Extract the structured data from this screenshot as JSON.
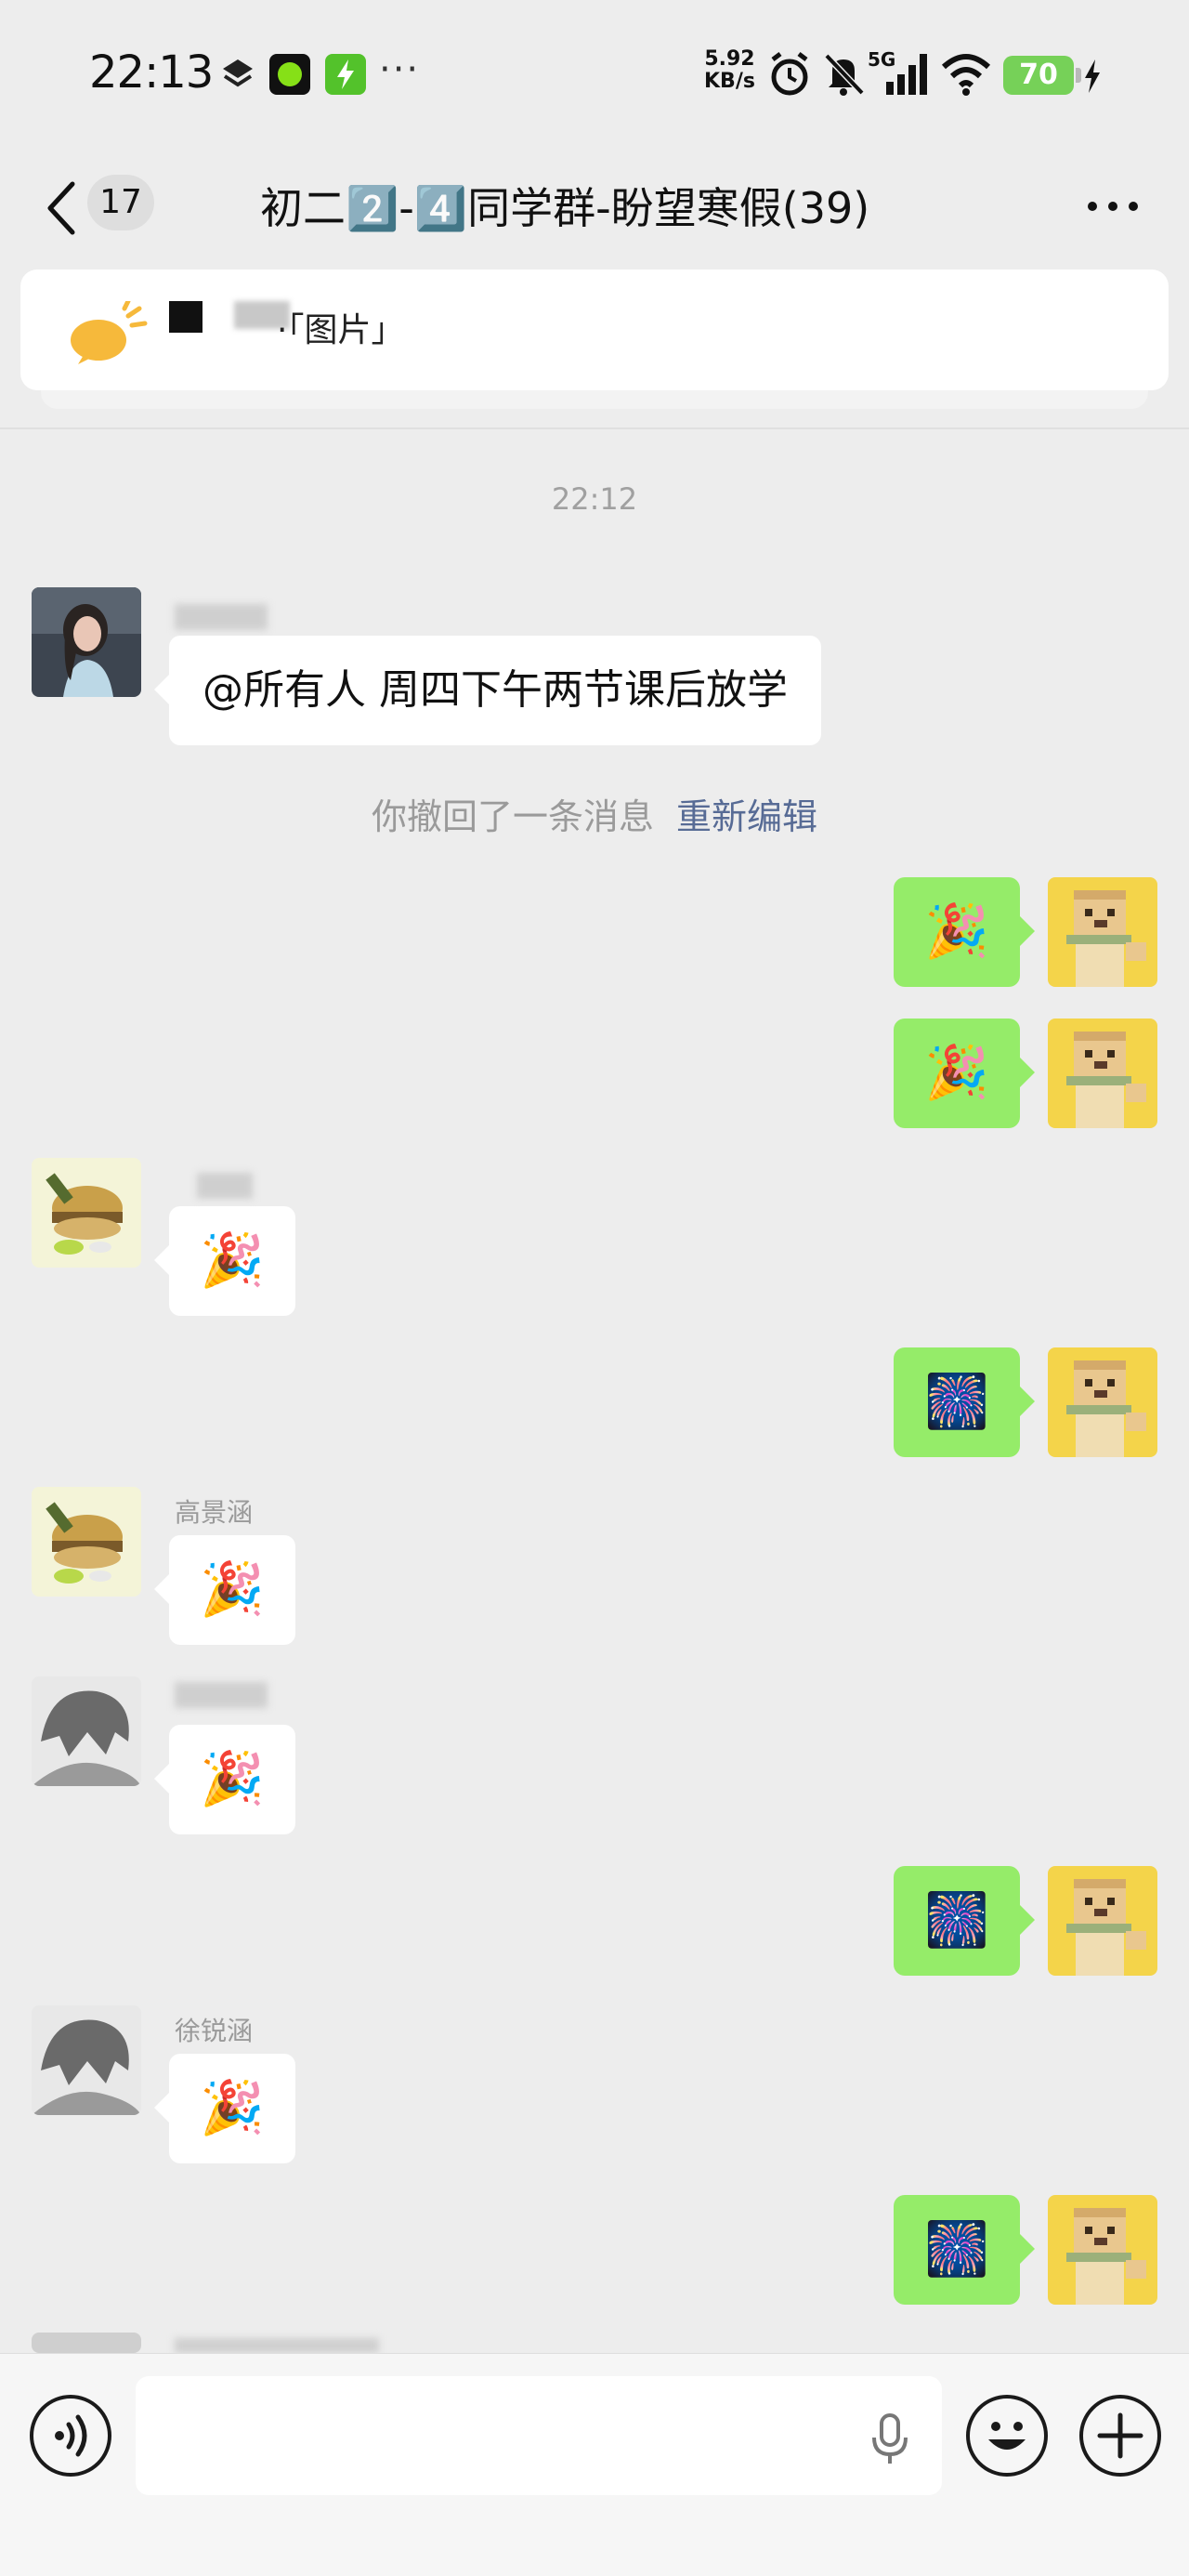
{
  "status_bar": {
    "time": "22:13",
    "net_speed_value": "5.92",
    "net_speed_unit": "KB/s",
    "network": "5G",
    "battery": "70"
  },
  "nav": {
    "unread_count": "17",
    "title": "初二2️⃣-4️⃣同学群-盼望寒假(39)"
  },
  "pinned_notice": {
    "text": "·「图片」"
  },
  "chat": {
    "timestamp": "22:12",
    "announcement": "@所有人  周四下午两节课后放学",
    "recall_text": "你撤回了一条消息",
    "recall_action": "重新编辑",
    "sender_names": [
      "高景涵",
      "徐锐涵"
    ],
    "emojis": {
      "party_popper": "🎉",
      "fireworks": "🎆"
    }
  },
  "input": {
    "placeholder": ""
  },
  "colors": {
    "self_bubble": "#95ec69",
    "link": "#576b95",
    "background": "#ededed"
  }
}
